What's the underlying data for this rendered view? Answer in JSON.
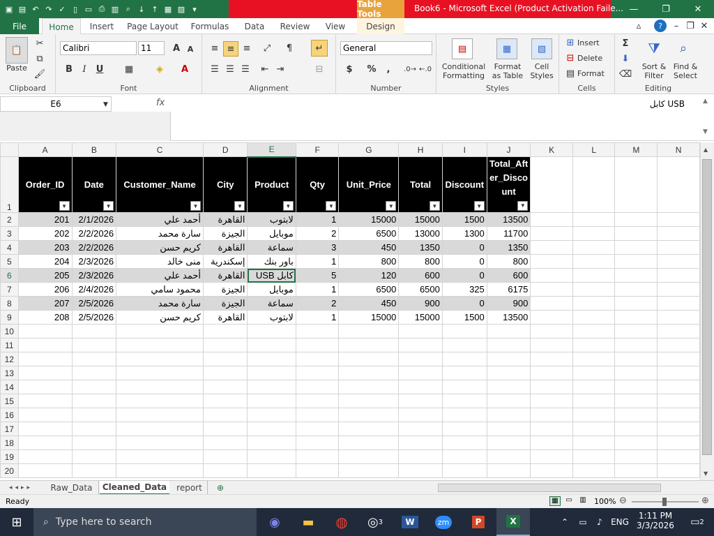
{
  "title": {
    "table_tools": "Table Tools",
    "text": "Book6 - Microsoft Excel (Product Activation Faile..."
  },
  "ribbon_tabs": [
    "File",
    "Home",
    "Insert",
    "Page Layout",
    "Formulas",
    "Data",
    "Review",
    "View",
    "Design"
  ],
  "ribbon": {
    "clipboard": {
      "label": "Clipboard",
      "paste": "Paste"
    },
    "font": {
      "label": "Font",
      "name": "Calibri",
      "size": "11"
    },
    "alignment": {
      "label": "Alignment"
    },
    "number": {
      "label": "Number",
      "format": "General",
      "currency": "$",
      "percent": "%",
      "comma": ","
    },
    "styles": {
      "label": "Styles",
      "conditional": "Conditional Formatting",
      "format_table": "Format as Table",
      "cell_styles": "Cell Styles"
    },
    "cells": {
      "label": "Cells",
      "insert": "Insert",
      "delete": "Delete",
      "format": "Format"
    },
    "editing": {
      "label": "Editing",
      "sort": "Sort & Filter",
      "find": "Find & Select"
    }
  },
  "formula_bar": {
    "name_box": "E6",
    "fx": "fx",
    "content": "كابل USB"
  },
  "columns": [
    "A",
    "B",
    "C",
    "D",
    "E",
    "F",
    "G",
    "H",
    "I",
    "J",
    "K",
    "L",
    "M",
    "N"
  ],
  "row_numbers": [
    "1",
    "2",
    "3",
    "4",
    "5",
    "6",
    "7",
    "8",
    "9",
    "10",
    "11",
    "12",
    "13",
    "14",
    "15",
    "16",
    "17",
    "18",
    "19",
    "20"
  ],
  "table": {
    "headers": [
      "Order_ID",
      "Date",
      "Customer_Name",
      "City",
      "Product",
      "Qty",
      "Unit_Price",
      "Total",
      "Discount",
      "Total_After_Discount"
    ],
    "rows": [
      [
        "201",
        "2/1/2026",
        "أحمد علي",
        "القاهرة",
        "لابتوب",
        "1",
        "15000",
        "15000",
        "1500",
        "13500"
      ],
      [
        "202",
        "2/2/2026",
        "سارة محمد",
        "الجيزة",
        "موبايل",
        "2",
        "6500",
        "13000",
        "1300",
        "11700"
      ],
      [
        "203",
        "2/2/2026",
        "كريم حسن",
        "القاهرة",
        "سماعة",
        "3",
        "450",
        "1350",
        "0",
        "1350"
      ],
      [
        "204",
        "2/3/2026",
        "منى خالد",
        "إسكندرية",
        "باور بنك",
        "1",
        "800",
        "800",
        "0",
        "800"
      ],
      [
        "205",
        "2/3/2026",
        "أحمد علي",
        "القاهرة",
        "كابل USB",
        "5",
        "120",
        "600",
        "0",
        "600"
      ],
      [
        "206",
        "2/4/2026",
        "محمود سامي",
        "الجيزة",
        "موبايل",
        "1",
        "6500",
        "6500",
        "325",
        "6175"
      ],
      [
        "207",
        "2/5/2026",
        "سارة محمد",
        "الجيزة",
        "سماعة",
        "2",
        "450",
        "900",
        "0",
        "900"
      ],
      [
        "208",
        "2/5/2026",
        "كريم حسن",
        "القاهرة",
        "لابتوب",
        "1",
        "15000",
        "15000",
        "1500",
        "13500"
      ]
    ]
  },
  "sheet_tabs": [
    "Raw_Data",
    "Cleaned_Data",
    "report"
  ],
  "active_sheet": "Cleaned_Data",
  "status": {
    "ready": "Ready",
    "zoom": "100%"
  },
  "taskbar": {
    "search_placeholder": "Type here to search",
    "language": "ENG",
    "time": "1:11 PM",
    "date": "3/3/2026",
    "notification_count": "2",
    "chrome_badge": "3"
  },
  "colors": {
    "excel_green": "#217346",
    "title_red": "#e81123",
    "table_tools": "#e8a33d",
    "header_black": "#000000",
    "band_gray": "#d9d9d9",
    "taskbar": "#202a3a"
  }
}
